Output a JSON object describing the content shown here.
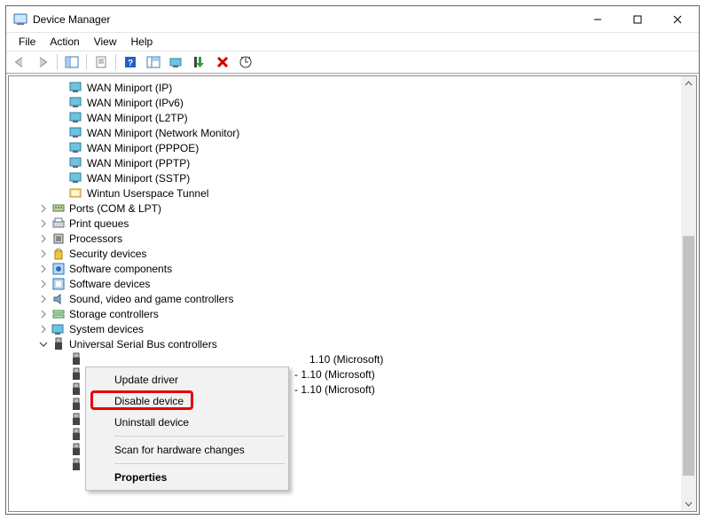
{
  "window": {
    "title": "Device Manager"
  },
  "menubar": [
    "File",
    "Action",
    "View",
    "Help"
  ],
  "tree": {
    "miniports": [
      "WAN Miniport (IP)",
      "WAN Miniport (IPv6)",
      "WAN Miniport (L2TP)",
      "WAN Miniport (Network Monitor)",
      "WAN Miniport (PPPOE)",
      "WAN Miniport (PPTP)",
      "WAN Miniport (SSTP)"
    ],
    "wintun": "Wintun Userspace Tunnel",
    "categories": [
      "Ports (COM & LPT)",
      "Print queues",
      "Processors",
      "Security devices",
      "Software components",
      "Software devices",
      "Sound, video and game controllers",
      "Storage controllers",
      "System devices"
    ],
    "usb_cat": "Universal Serial Bus controllers",
    "usb_rows": [
      " 1.10 (Microsoft)",
      " - 1.10 (Microsoft)",
      " - 1.10 (Microsoft)"
    ]
  },
  "context": {
    "update": "Update driver",
    "disable": "Disable device",
    "uninstall": "Uninstall device",
    "scan": "Scan for hardware changes",
    "properties": "Properties"
  }
}
